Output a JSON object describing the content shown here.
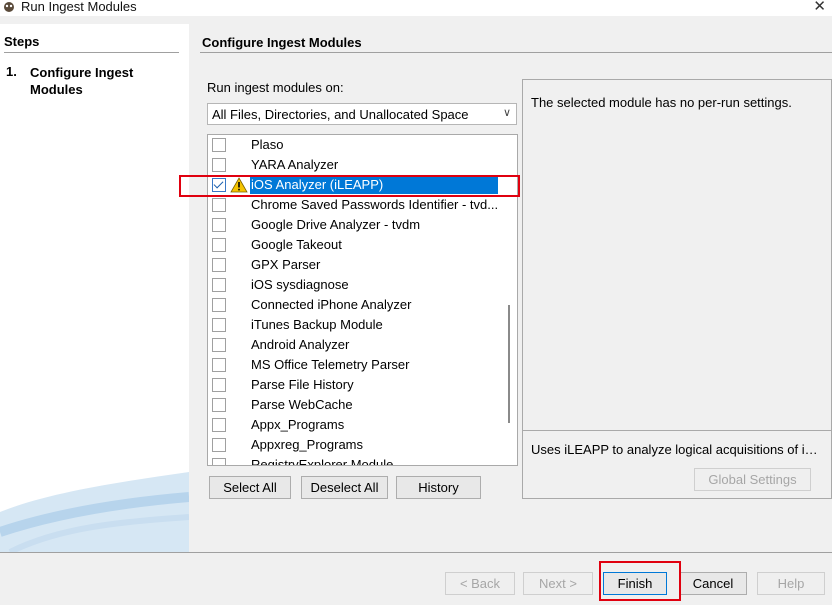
{
  "window": {
    "title": "Run Ingest Modules"
  },
  "steps": {
    "title": "Steps",
    "items": [
      {
        "number": "1.",
        "label": "Configure Ingest Modules"
      }
    ]
  },
  "main": {
    "title": "Configure Ingest Modules",
    "run_on_label": "Run ingest modules on:",
    "run_on_value": "All Files, Directories, and Unallocated Space"
  },
  "modules": [
    {
      "label": "Plaso",
      "checked": false,
      "selected": false,
      "warning": false
    },
    {
      "label": "YARA Analyzer",
      "checked": false,
      "selected": false,
      "warning": false
    },
    {
      "label": "iOS Analyzer (iLEAPP)",
      "checked": true,
      "selected": true,
      "warning": true
    },
    {
      "label": "Chrome Saved Passwords Identifier - tvd...",
      "checked": false,
      "selected": false,
      "warning": false
    },
    {
      "label": "Google Drive Analyzer - tvdm",
      "checked": false,
      "selected": false,
      "warning": false
    },
    {
      "label": "Google Takeout",
      "checked": false,
      "selected": false,
      "warning": false
    },
    {
      "label": "GPX Parser",
      "checked": false,
      "selected": false,
      "warning": false
    },
    {
      "label": "iOS sysdiagnose",
      "checked": false,
      "selected": false,
      "warning": false
    },
    {
      "label": "Connected iPhone Analyzer",
      "checked": false,
      "selected": false,
      "warning": false
    },
    {
      "label": "iTunes Backup Module",
      "checked": false,
      "selected": false,
      "warning": false
    },
    {
      "label": "Android Analyzer",
      "checked": false,
      "selected": false,
      "warning": false
    },
    {
      "label": "MS Office Telemetry Parser",
      "checked": false,
      "selected": false,
      "warning": false
    },
    {
      "label": "Parse File History",
      "checked": false,
      "selected": false,
      "warning": false
    },
    {
      "label": "Parse WebCache",
      "checked": false,
      "selected": false,
      "warning": false
    },
    {
      "label": "Appx_Programs",
      "checked": false,
      "selected": false,
      "warning": false
    },
    {
      "label": "Appxreg_Programs",
      "checked": false,
      "selected": false,
      "warning": false
    },
    {
      "label": "RegistryExplorer Module",
      "checked": false,
      "selected": false,
      "warning": false
    }
  ],
  "list_buttons": {
    "select_all": "Select All",
    "deselect_all": "Deselect All",
    "history": "History"
  },
  "settings": {
    "per_run_text": "The selected module has no per-run settings.",
    "description": "Uses iLEAPP to analyze logical acquisitions of iOS devices.",
    "global_settings": "Global Settings"
  },
  "nav": {
    "back": "< Back",
    "next": "Next >",
    "finish": "Finish",
    "cancel": "Cancel",
    "help": "Help"
  },
  "colors": {
    "selection": "#0078d7",
    "highlight": "#e0000f"
  }
}
